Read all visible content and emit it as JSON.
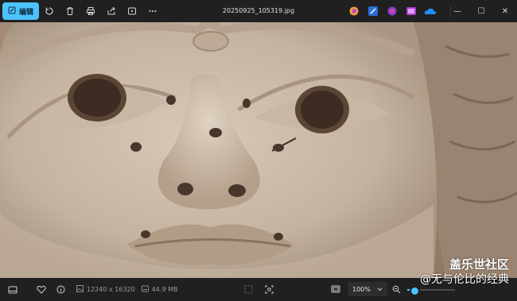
{
  "toolbar": {
    "edit_label": "编辑",
    "file_name": "20250925_105319.jpg",
    "icons": [
      "rotate-icon",
      "delete-icon",
      "print-icon",
      "share-icon",
      "slideshow-icon",
      "more-icon"
    ],
    "apps": [
      {
        "name": "copilot-icon",
        "color": "#e8a33a"
      },
      {
        "name": "clipchamp-icon",
        "color": "#2a6fd6"
      },
      {
        "name": "designer-icon",
        "color": "#8a3fd1"
      },
      {
        "name": "photo-editor-icon",
        "color": "#b03fd1"
      },
      {
        "name": "onedrive-icon",
        "color": "#1e90ff"
      }
    ]
  },
  "window": {
    "minimize": "—",
    "maximize": "☐",
    "close": "✕"
  },
  "status": {
    "dimensions": "12240 x 16320",
    "file_size": "44.9 MB",
    "zoom": "100%",
    "zoom_fraction": 0.15
  },
  "watermark": {
    "line1": "盖乐世社区",
    "line2": "@无与伦比的经典"
  }
}
